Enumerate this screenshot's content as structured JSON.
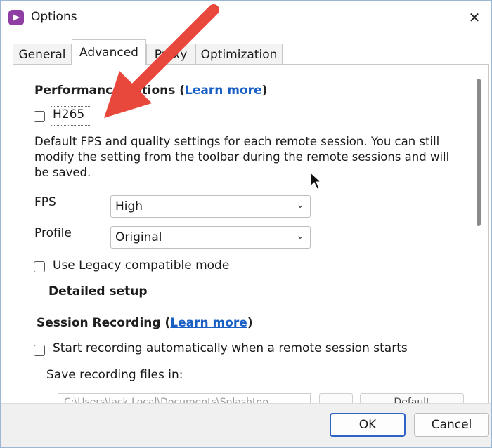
{
  "window": {
    "title": "Options",
    "close_glyph": "✕"
  },
  "tabs": [
    {
      "label": "General"
    },
    {
      "label": "Advanced"
    },
    {
      "label": "Proxy"
    },
    {
      "label": "Optimization"
    }
  ],
  "performance": {
    "heading": "Performance options (",
    "learn_more": "Learn more",
    "heading_close": ")",
    "h265_label": "H265",
    "description": "Default FPS and quality settings for each remote session. You can still modify the setting from the toolbar during the remote sessions and will be saved.",
    "fps_label": "FPS",
    "fps_value": "High",
    "profile_label": "Profile",
    "profile_value": "Original",
    "legacy_label": "Use Legacy compatible mode",
    "detailed_setup": "Detailed setup"
  },
  "recording": {
    "heading": "Session Recording (",
    "learn_more": "Learn more",
    "heading_close": ")",
    "auto_start_label": "Start recording automatically when a remote session starts",
    "save_in_label": "Save recording files in:",
    "path_value": "C:\\Users\\Jack.Local\\Documents\\Splashtop",
    "default_label": "Default"
  },
  "buttons": {
    "ok": "OK",
    "cancel": "Cancel"
  },
  "colors": {
    "annotation_arrow": "#e8483b",
    "link": "#1a5fc4",
    "app_icon": "#8f3fa3"
  },
  "icons": {
    "app": "app-logo-icon",
    "close": "close-icon",
    "dropdown": "chevron-down-icon",
    "cursor": "mouse-pointer-icon",
    "annotation": "red-arrow-annotation"
  }
}
